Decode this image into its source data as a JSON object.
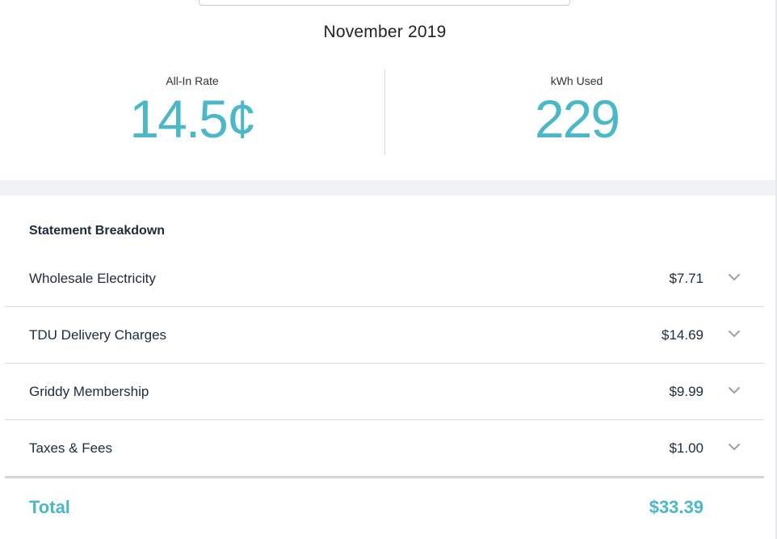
{
  "colors": {
    "accent": "#4ab8c7",
    "text": "#1d2b3a",
    "divider": "#d9dbde",
    "band": "#f1f2f3"
  },
  "header": {
    "period": "November 2019"
  },
  "stats": {
    "rate": {
      "label": "All-In Rate",
      "value": "14.5¢"
    },
    "usage": {
      "label": "kWh Used",
      "value": "229"
    }
  },
  "breakdown": {
    "title": "Statement Breakdown",
    "items": [
      {
        "label": "Wholesale Electricity",
        "amount": "$7.71",
        "icon": "chevron-down-icon"
      },
      {
        "label": "TDU Delivery Charges",
        "amount": "$14.69",
        "icon": "chevron-down-icon"
      },
      {
        "label": "Griddy Membership",
        "amount": "$9.99",
        "icon": "chevron-down-icon"
      },
      {
        "label": "Taxes & Fees",
        "amount": "$1.00",
        "icon": "chevron-down-icon"
      }
    ]
  },
  "total": {
    "label": "Total",
    "amount": "$33.39"
  }
}
